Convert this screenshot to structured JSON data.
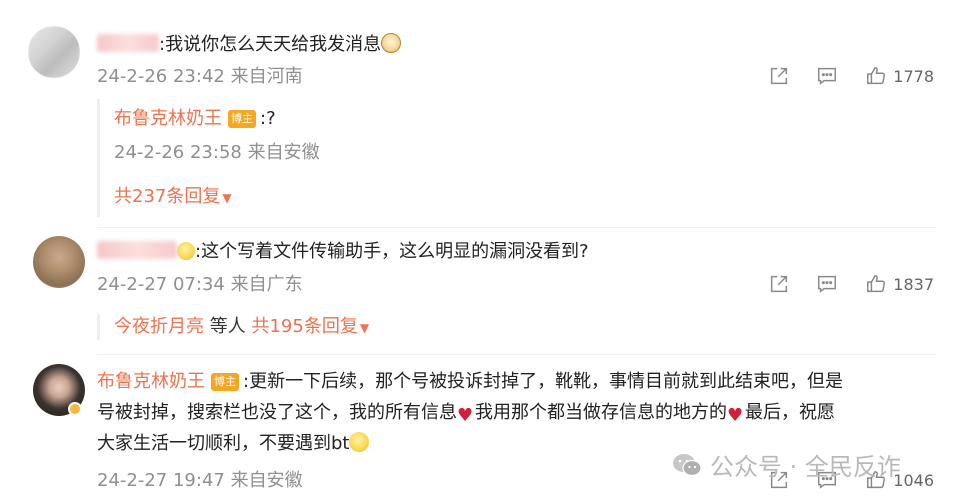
{
  "comments": [
    {
      "text": ":我说你怎么天天给我发消息",
      "time": "24-2-26 23:42",
      "location": "来自河南",
      "likes": "1778",
      "reply": {
        "author": "布鲁克林奶王",
        "badge": "博主",
        "text": ":?",
        "time": "24-2-26 23:58",
        "location": "来自安徽"
      },
      "more_replies": "共237条回复"
    },
    {
      "text": ":这个写着文件传输助手，这么明显的漏洞没看到?",
      "time": "24-2-27 07:34",
      "location": "来自广东",
      "likes": "1837",
      "replied_by": "今夜折月亮",
      "replied_by_suffix": "等人",
      "more_replies": "共195条回复"
    },
    {
      "author": "布鲁克林奶王",
      "badge": "博主",
      "text_line1": ":更新一下后续，那个号被投诉封掉了，靴靴，事情目前就到此结束吧，但是",
      "text_line2a": "号被封掉，搜索栏也没了这个，我的所有信息",
      "text_line2b": "我用那个都当做存信息的地方的",
      "text_line2c": "最后，祝愿",
      "text_line3": "大家生活一切顺利，不要遇到bt",
      "time": "24-2-27 19:47",
      "location": "来自安徽",
      "likes": "1046"
    }
  ],
  "watermark": "公众号 · 全民反诈",
  "icons": {
    "share": "share-icon",
    "comment": "comment-icon",
    "like": "thumbs-up-icon"
  },
  "colors": {
    "accent": "#eb7350",
    "meta": "#8f8f8f",
    "badge": "#f5a623"
  }
}
